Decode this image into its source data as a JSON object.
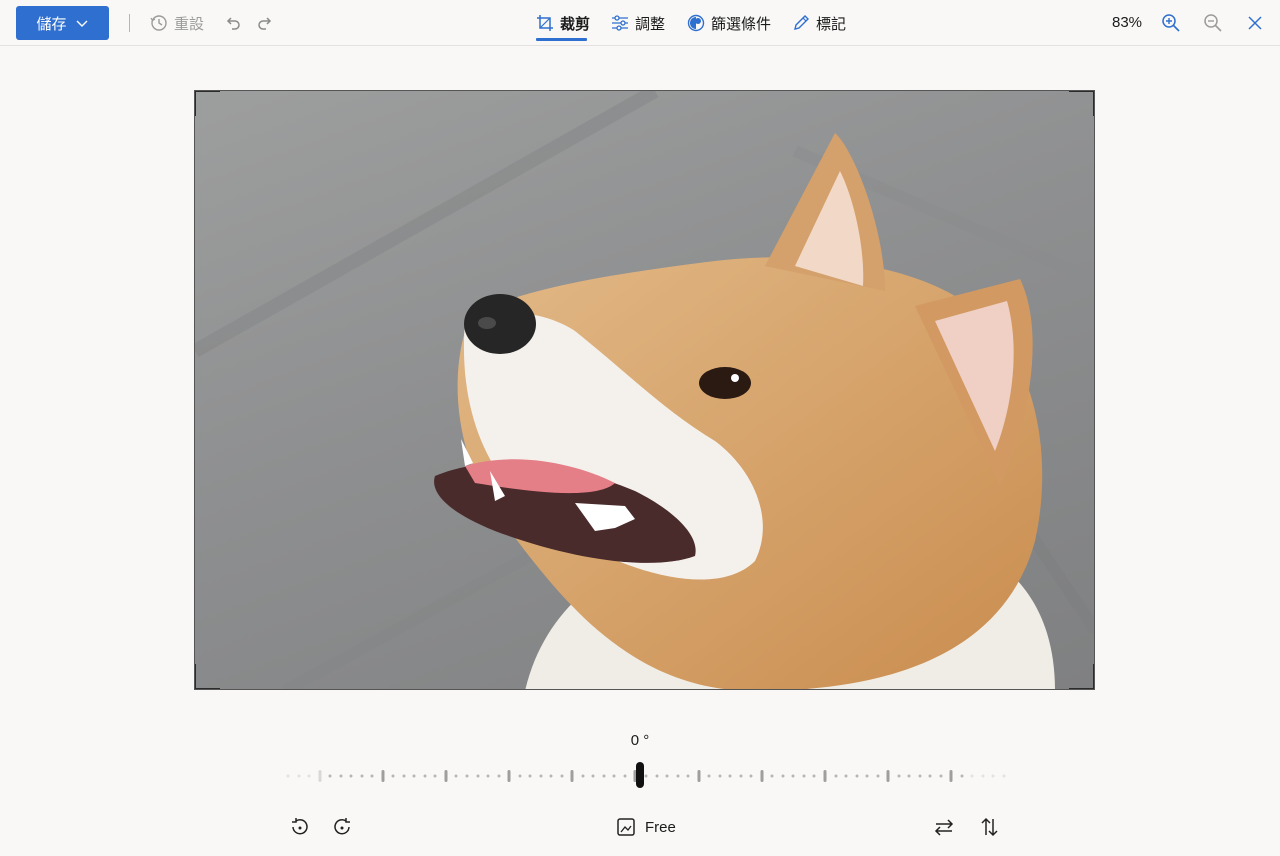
{
  "toolbar": {
    "save_label": "儲存",
    "reset_label": "重設",
    "tabs": [
      {
        "label": "裁剪",
        "icon": "crop-icon",
        "active": true
      },
      {
        "label": "調整",
        "icon": "sliders-icon",
        "active": false
      },
      {
        "label": "篩選條件",
        "icon": "filter-icon",
        "active": false
      },
      {
        "label": "標記",
        "icon": "pen-icon",
        "active": false
      }
    ],
    "zoom": "83%"
  },
  "photo": {
    "subject": "shiba-inu-dog-photo"
  },
  "rotation": {
    "angle_label": "0 °",
    "angle_value": 0
  },
  "bottom": {
    "aspect_label": "Free"
  },
  "colors": {
    "accent": "#2f6fcf",
    "background": "#f9f8f7"
  }
}
